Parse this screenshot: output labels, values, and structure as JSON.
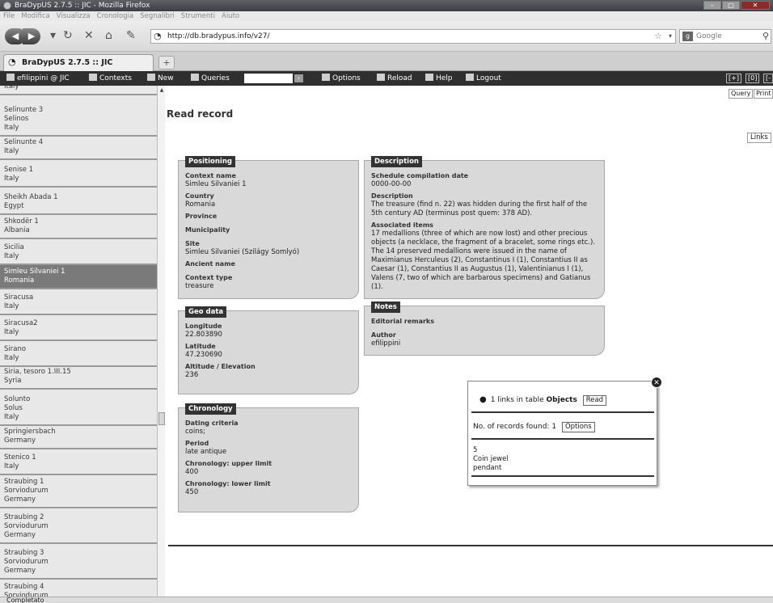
{
  "window": {
    "title": "BraDypUS 2.7.5 :: JIC - Mozilla Firefox",
    "menu": [
      "File",
      "Modifica",
      "Visualizza",
      "Cronologia",
      "Segnalibri",
      "Strumenti",
      "Aiuto"
    ],
    "url": "http://db.bradypus.info/v27/",
    "search_placeholder": "Google",
    "tab_title": "BraDypUS 2.7.5 :: JIC",
    "status": "Completato"
  },
  "toolbar": {
    "user": "efilippini @ JIC",
    "contexts": "Contexts",
    "new": "New",
    "queries": "Queries",
    "options": "Options",
    "reload": "Reload",
    "help": "Help",
    "logout": "Logout",
    "right": [
      "[+]",
      "[0]",
      "[-"
    ]
  },
  "sidebar": {
    "items": [
      {
        "lines": [
          "Italy"
        ]
      },
      {
        "lines": [
          "Selinunte 3",
          "Selinos",
          "Italy"
        ]
      },
      {
        "lines": [
          "Selinunte 4",
          "Italy"
        ]
      },
      {
        "lines": [
          "Senise 1",
          "Italy"
        ]
      },
      {
        "lines": [
          "Sheikh Abada 1",
          "Egypt"
        ]
      },
      {
        "lines": [
          "Shkodër 1",
          "Albania"
        ]
      },
      {
        "lines": [
          "Sicilia",
          "Italy"
        ]
      },
      {
        "lines": [
          "Simleu Silvaniei 1",
          "Romania"
        ],
        "selected": true
      },
      {
        "lines": [
          "Siracusa",
          "Italy"
        ]
      },
      {
        "lines": [
          "Siracusa2",
          "Italy"
        ]
      },
      {
        "lines": [
          "Sirano",
          "Italy"
        ]
      },
      {
        "lines": [
          "Siria, tesoro 1.III.15",
          "Syria"
        ]
      },
      {
        "lines": [
          "Solunto",
          "Solus",
          "Italy"
        ]
      },
      {
        "lines": [
          "Springiersbach",
          "Germany"
        ]
      },
      {
        "lines": [
          "Stenico 1",
          "Italy"
        ]
      },
      {
        "lines": [
          "Straubing 1",
          "Sorviodurum",
          "Germany"
        ]
      },
      {
        "lines": [
          "Straubing 2",
          "Sorviodurum",
          "Germany"
        ]
      },
      {
        "lines": [
          "Straubing 3",
          "Sorviodurum",
          "Germany"
        ]
      },
      {
        "lines": [
          "Straubing 4",
          "Sorviodurum"
        ]
      }
    ]
  },
  "main": {
    "query_label": "Query",
    "print_label": "Print",
    "title": "Read record",
    "links_label": "Links",
    "positioning": {
      "title": "Positioning",
      "fields": [
        {
          "label": "Context name",
          "value": "Simleu Silvaniei 1"
        },
        {
          "label": "Country",
          "value": "Romania"
        },
        {
          "label": "Province",
          "value": ""
        },
        {
          "label": "Municipality",
          "value": ""
        },
        {
          "label": "Site",
          "value": "Simleu Silvaniei (Szilágy Somlyó)"
        },
        {
          "label": "Ancient name",
          "value": ""
        },
        {
          "label": "Context type",
          "value": "treasure"
        }
      ]
    },
    "geo": {
      "title": "Geo data",
      "fields": [
        {
          "label": "Longitude",
          "value": "22.803890"
        },
        {
          "label": "Latitude",
          "value": "47.230690"
        },
        {
          "label": "Altitude / Elevation",
          "value": "236"
        }
      ]
    },
    "chronology": {
      "title": "Chronology",
      "fields": [
        {
          "label": "Dating criteria",
          "value": "coins;"
        },
        {
          "label": "Period",
          "value": "late antique"
        },
        {
          "label": "Chronology: upper limit",
          "value": "400"
        },
        {
          "label": "Chronology: lower limit",
          "value": "450"
        }
      ]
    },
    "description": {
      "title": "Description",
      "fields": [
        {
          "label": "Schedule compilation date",
          "value": "0000-00-00"
        },
        {
          "label": "Description",
          "value": "The treasure (find n. 22) was hidden during the first half of the 5th century AD (terminus post quem: 378 AD)."
        },
        {
          "label": "Associated items",
          "value": "17 medallions (three of which are now lost) and other precious objects (a necklace, the fragment of a bracelet, some rings etc.). The 14 preserved medallions were issued in the name of Maximianus Herculeus (2), Constantinus I (1), Constantius II as Caesar (1), Constantius II as Augustus (1), Valentinianus I (1), Valens (7, two of which are barbarous specimens) and Gatianus (1)."
        }
      ]
    },
    "notes": {
      "title": "Notes",
      "fields": [
        {
          "label": "Editorial remarks",
          "value": ""
        },
        {
          "label": "Author",
          "value": "efilippini"
        }
      ]
    }
  },
  "links_popup": {
    "bullet": "●",
    "text_prefix": "1 links in table",
    "table_name": "Objects",
    "read_label": "Read",
    "records_found": "No. of records found: 1",
    "options_label": "Options",
    "record_lines": [
      "5",
      "Coin jewel",
      "pendant"
    ]
  },
  "icons": {
    "back": "back-arrow-icon",
    "forward": "forward-arrow-icon",
    "reload": "reload-icon",
    "stop": "stop-icon",
    "home": "home-icon",
    "close": "close-icon"
  }
}
